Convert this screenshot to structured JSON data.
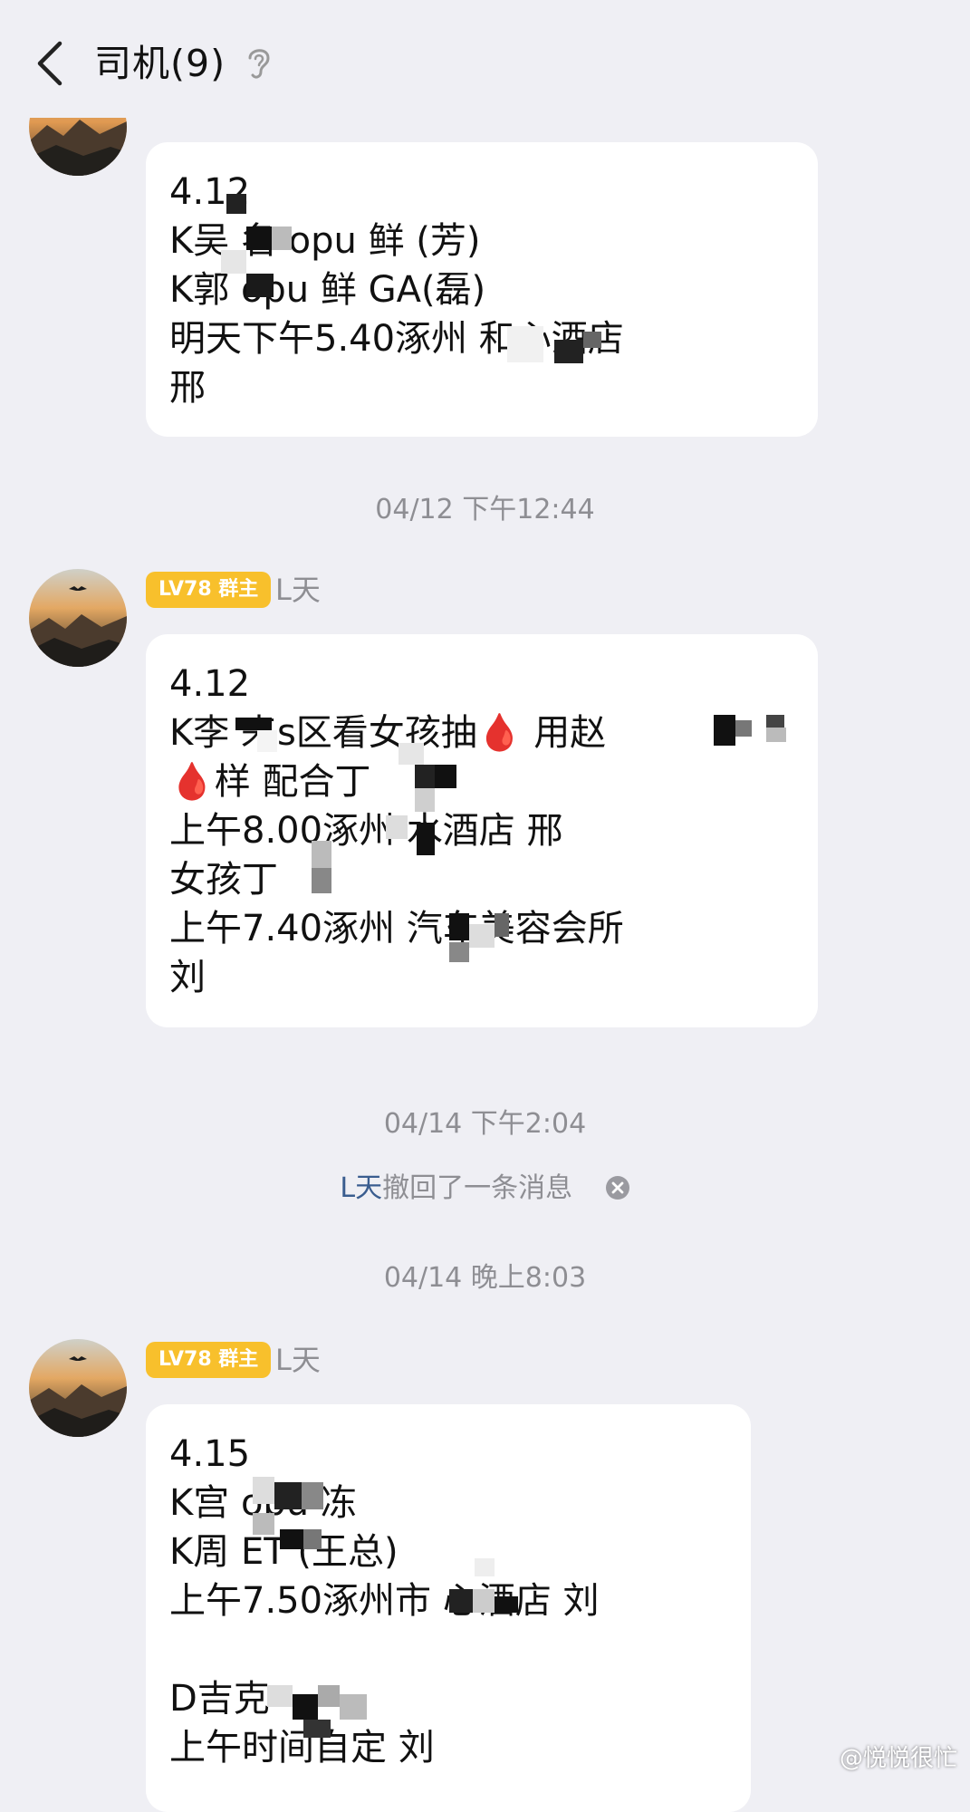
{
  "header": {
    "title": "司机(9)"
  },
  "messages": [
    {
      "lines": [
        "4.12",
        "K吴 名 opu 鲜 (芳)",
        "K郭 opu 鲜 GA(磊)",
        "明天下午5.40涿州 和心酒店",
        "邢"
      ]
    },
    {
      "timestamp": "04/12 下午12:44",
      "badge": "LV78 群主",
      "sender": "L天",
      "lines": [
        "4.12",
        "K李 来s区看女孩抽🩸 用赵",
        "🩸样  配合丁",
        "上午8.00涿州  水酒店  邢",
        "女孩丁",
        "上午7.40涿州  汽车美容会所",
        "刘"
      ]
    },
    {
      "timestamp": "04/14 下午2:04"
    },
    {
      "recall_name": "L天",
      "recall_text": "撤回了一条消息"
    },
    {
      "timestamp": "04/14 晚上8:03",
      "badge": "LV78 群主",
      "sender": "L天",
      "lines": [
        "4.15",
        "K宫 opu 冻",
        "K周 ET (王总)",
        "上午7.50涿州市 心酒店  刘",
        "",
        "D吉克",
        "上午时间自定  刘"
      ]
    }
  ],
  "watermark": "@悦悦很忙",
  "colors": {
    "background": "#efeff4",
    "bubble": "#ffffff",
    "badge": "#f8c02c",
    "timestamp": "#8e8e93",
    "recall_name": "#3a5d8f"
  }
}
